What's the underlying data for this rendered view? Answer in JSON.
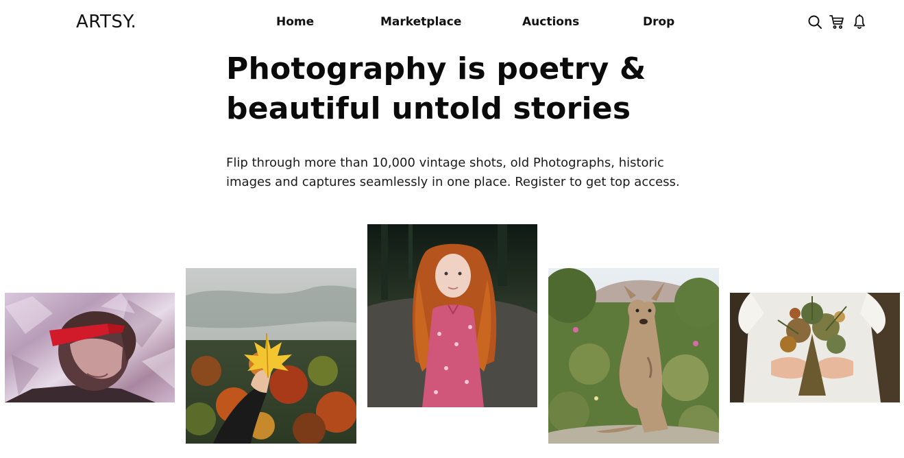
{
  "header": {
    "logo": "ARTSY.",
    "nav": [
      {
        "label": "Home"
      },
      {
        "label": "Marketplace"
      },
      {
        "label": "Auctions"
      },
      {
        "label": "Drop"
      }
    ],
    "icons": [
      "search-icon",
      "cart-icon",
      "bell-icon"
    ]
  },
  "hero": {
    "title_line1": "Photography is poetry &",
    "title_line2": "beautiful untold stories",
    "description_line1": "Flip through more than 10,000 vintage shots, old Photographs, historic",
    "description_line2": "images and captures seamlessly in one place. Register to get top access."
  },
  "gallery": [
    {
      "subject": "person with red sunglasses on crumpled foil background"
    },
    {
      "subject": "hand holding a yellow maple leaf over autumn forest"
    },
    {
      "subject": "red curly-haired girl in pink floral dress"
    },
    {
      "subject": "kangaroo standing in grassland"
    },
    {
      "subject": "hands holding a bouquet of dried flowers"
    }
  ]
}
